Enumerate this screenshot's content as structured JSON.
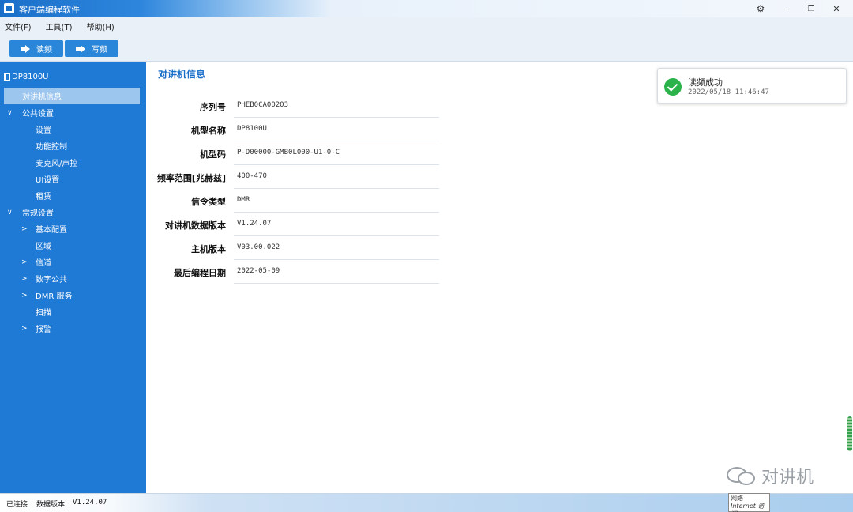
{
  "window": {
    "title": "客户端编程软件",
    "controls": {
      "settings": "⚙",
      "minimize": "–",
      "restore": "❐",
      "close": "✕"
    }
  },
  "menu": [
    "文件(F)",
    "工具(T)",
    "帮助(H)"
  ],
  "toolbar": {
    "read_label": "读频",
    "write_label": "写频"
  },
  "sidebar": {
    "device": "DP8100U",
    "items": [
      {
        "label": "对讲机信息",
        "selected": true
      },
      {
        "label": "公共设置",
        "expanded": true
      },
      {
        "label": "设置"
      },
      {
        "label": "功能控制"
      },
      {
        "label": "麦克风/声控"
      },
      {
        "label": "UI设置"
      },
      {
        "label": "租赁"
      },
      {
        "label": "常规设置",
        "expanded": true
      },
      {
        "label": "基本配置",
        "collapsed": true
      },
      {
        "label": "区域"
      },
      {
        "label": "信道",
        "collapsed": true
      },
      {
        "label": "数字公共",
        "collapsed": true
      },
      {
        "label": "DMR 服务",
        "collapsed": true
      },
      {
        "label": "扫描"
      },
      {
        "label": "报警",
        "collapsed": true
      }
    ]
  },
  "content": {
    "title": "对讲机信息",
    "fields": [
      {
        "label": "序列号",
        "value": "PHEB0CA00203"
      },
      {
        "label": "机型名称",
        "value": "DP8100U"
      },
      {
        "label": "机型码",
        "value": "P-D00000-GMB0L000-U1-0-C"
      },
      {
        "label": "频率范围[兆赫兹]",
        "value": "400-470"
      },
      {
        "label": "信令类型",
        "value": "DMR"
      },
      {
        "label": "对讲机数据版本",
        "value": "V1.24.07"
      },
      {
        "label": "主机版本",
        "value": "V03.00.022"
      },
      {
        "label": "最后编程日期",
        "value": "2022-05-09"
      }
    ]
  },
  "toast": {
    "title": "读频成功",
    "time": "2022/05/18 11:46:47"
  },
  "statusbar": {
    "connection": "已连接",
    "data_version_label": "数据版本:",
    "data_version": "V1.24.07"
  },
  "network_popup": {
    "line1": "网络",
    "line2": "Internet 访问"
  },
  "watermark": {
    "text": "对讲机"
  }
}
